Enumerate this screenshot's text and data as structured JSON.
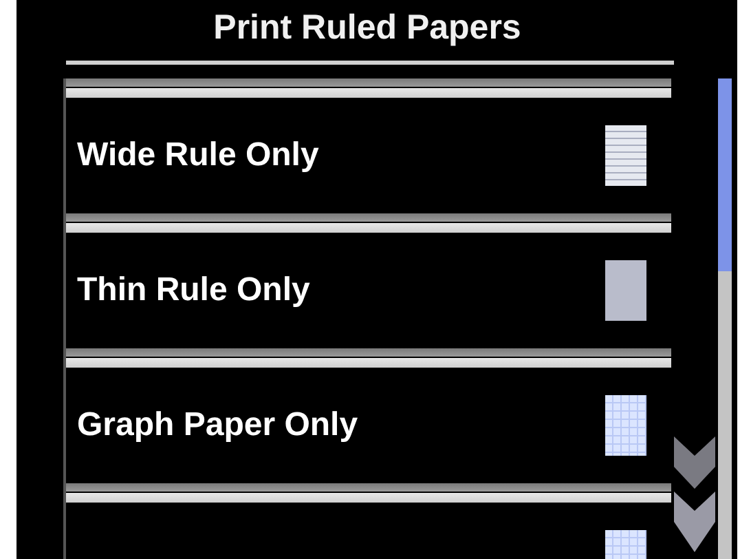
{
  "screen": {
    "title": "Print Ruled Papers"
  },
  "options": [
    {
      "label": "Wide Rule Only",
      "kind": "wide-rule"
    },
    {
      "label": "Thin Rule Only",
      "kind": "thin-rule"
    },
    {
      "label": "Graph Paper Only",
      "kind": "graph"
    },
    {
      "kind": "graph"
    }
  ]
}
